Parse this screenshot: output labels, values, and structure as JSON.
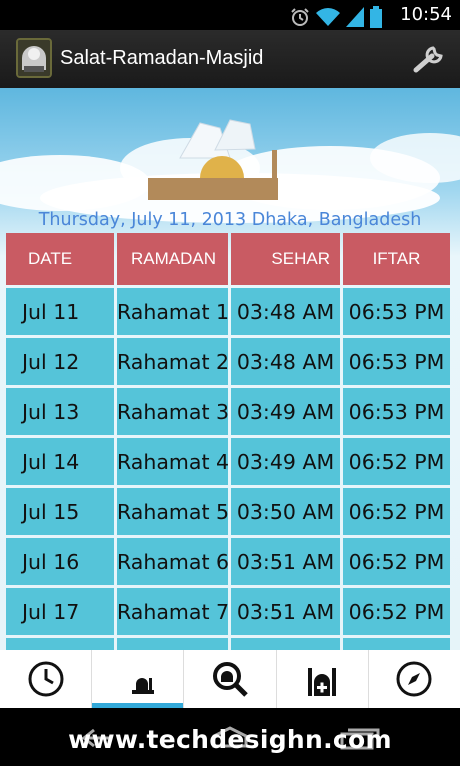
{
  "status_bar": {
    "time": "10:54",
    "icons": [
      "alarm-icon",
      "wifi-icon",
      "signal-icon",
      "battery-icon"
    ]
  },
  "action_bar": {
    "title": "Salat-Ramadan-Masjid",
    "app_icon": "mosque-logo-icon",
    "settings_icon": "wrench-icon"
  },
  "header_info": {
    "date_location": "Thursday, July 11, 2013  Dhaka, Bangladesh"
  },
  "table": {
    "columns": [
      "DATE",
      "RAMADAN",
      "SEHAR",
      "IFTAR"
    ],
    "rows": [
      [
        "Jul 11",
        "Rahamat  1",
        "03:48 AM",
        "06:53 PM"
      ],
      [
        "Jul 12",
        "Rahamat  2",
        "03:48 AM",
        "06:53 PM"
      ],
      [
        "Jul 13",
        "Rahamat  3",
        "03:49 AM",
        "06:53 PM"
      ],
      [
        "Jul 14",
        "Rahamat  4",
        "03:49 AM",
        "06:52 PM"
      ],
      [
        "Jul 15",
        "Rahamat  5",
        "03:50 AM",
        "06:52 PM"
      ],
      [
        "Jul 16",
        "Rahamat  6",
        "03:51 AM",
        "06:52 PM"
      ],
      [
        "Jul 17",
        "Rahamat  7",
        "03:51 AM",
        "06:52 PM"
      ]
    ]
  },
  "tabs": [
    {
      "icon": "clock-icon",
      "active": false
    },
    {
      "icon": "ramadan-mosque-icon",
      "active": true
    },
    {
      "icon": "mosque-search-icon",
      "active": false
    },
    {
      "icon": "mosque-add-icon",
      "active": false
    },
    {
      "icon": "compass-icon",
      "active": false
    }
  ],
  "watermark": "www.techdesighn.com",
  "colors": {
    "header_cell": "#c95b63",
    "row_cell": "#55c4d9",
    "date_text": "#4a86d8",
    "active_tab": "#33a9d9"
  }
}
